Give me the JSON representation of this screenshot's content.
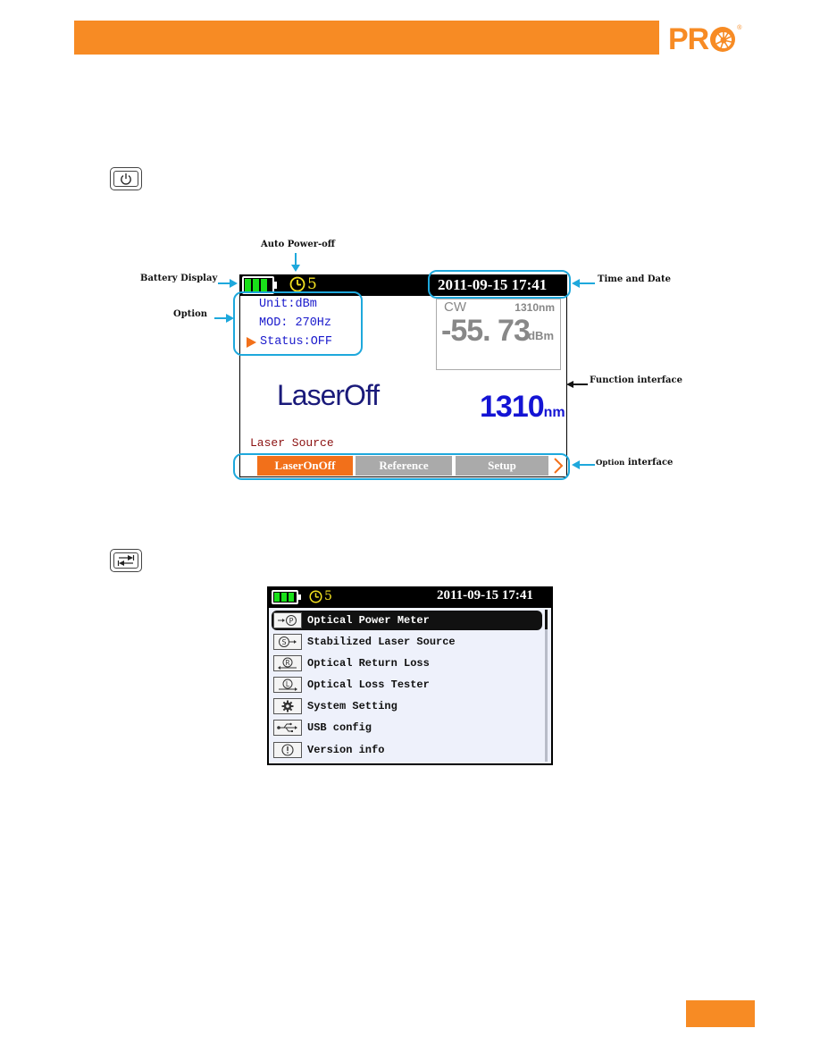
{
  "header": {
    "brand_logo_text": "PRO",
    "brand_color": "#f78b24"
  },
  "keys": {
    "power_key_icon": "power-icon",
    "switch_key_icon": "switch-arrows-icon"
  },
  "annotations": {
    "auto_power_off": "Auto Power-off",
    "battery_display": "Battery Display",
    "option": "Option",
    "time_and_date": "Time and Date",
    "function_interface": "Function interface",
    "option_interface_small": "Option",
    "option_interface_rest": "interface"
  },
  "screen1": {
    "battery_level_bars": 3,
    "battery_total_bars": 4,
    "auto_off_minutes": "5",
    "datetime": "2011-09-15  17:41",
    "options": [
      {
        "label": "Unit:dBm",
        "selected": false
      },
      {
        "label": "MOD: 270Hz",
        "selected": false
      },
      {
        "label": "Status:OFF",
        "selected": true
      }
    ],
    "meter": {
      "mode": "CW",
      "wavelength": "1310nm",
      "value": "-55. 73",
      "unit": "dBm"
    },
    "laser_status": "LaserOff",
    "wavelength_value": "1310",
    "wavelength_unit": "nm",
    "function_name": "Laser Source",
    "option_buttons": [
      {
        "label": "LaserOnOff",
        "active": true
      },
      {
        "label": "Reference",
        "active": false
      },
      {
        "label": "Setup",
        "active": false
      }
    ],
    "next_arrow": "›",
    "colors": {
      "active_button": "#f2701a",
      "inactive_button": "#aaaaaa",
      "option_text": "#1a1acc",
      "annotation_outline": "#1ea8dc"
    }
  },
  "screen2": {
    "battery_level_bars": 3,
    "auto_off_minutes": "5",
    "datetime": "2011-09-15  17:41",
    "menu_items": [
      {
        "label": "Optical Power Meter",
        "icon": "power-meter-icon",
        "selected": true
      },
      {
        "label": "Stabilized Laser Source",
        "icon": "laser-source-icon",
        "selected": false
      },
      {
        "label": "Optical Return Loss",
        "icon": "return-loss-icon",
        "selected": false
      },
      {
        "label": "Optical Loss Tester",
        "icon": "loss-tester-icon",
        "selected": false
      },
      {
        "label": "System Setting",
        "icon": "gear-icon",
        "selected": false
      },
      {
        "label": "USB config",
        "icon": "usb-icon",
        "selected": false
      },
      {
        "label": "Version info",
        "icon": "info-icon",
        "selected": false
      }
    ]
  }
}
